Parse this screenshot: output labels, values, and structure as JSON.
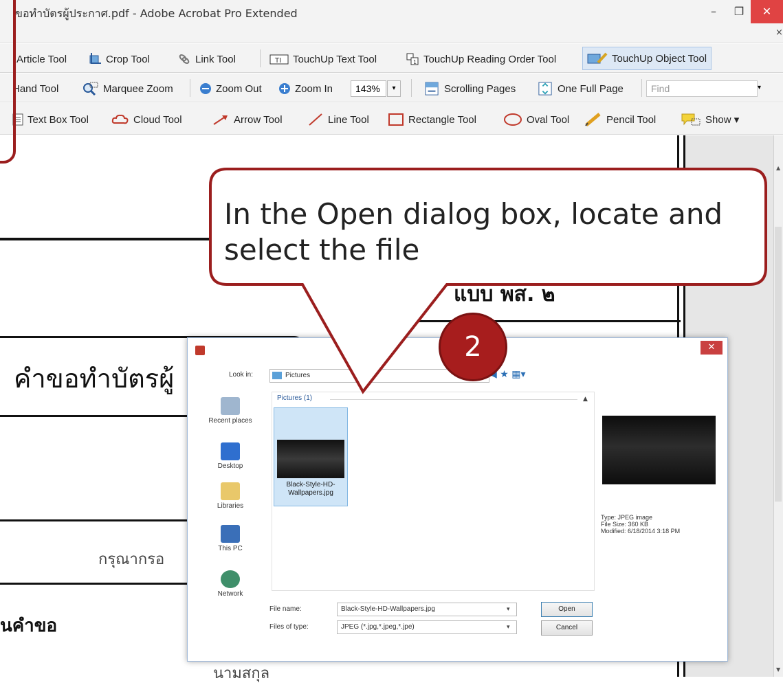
{
  "window": {
    "title": "ขอทำบัตรผู้ประกาศ.pdf - Adobe Acrobat Pro Extended",
    "min": "–",
    "max": "❐",
    "close": "✕",
    "menu_close": "×"
  },
  "toolbar1": {
    "items": [
      "Article Tool",
      "Crop Tool",
      "Link Tool",
      "TouchUp Text Tool",
      "TouchUp Reading Order Tool",
      "TouchUp Object Tool"
    ]
  },
  "toolbar2": {
    "hand": "Hand Tool",
    "marquee": "Marquee Zoom",
    "zoom_out": "Zoom Out",
    "zoom_in": "Zoom In",
    "zoom_value": "143%",
    "scrolling": "Scrolling Pages",
    "one_full": "One Full Page",
    "find_placeholder": "Find"
  },
  "toolbar3": {
    "items": [
      "Text Box Tool",
      "Cloud Tool",
      "Arrow Tool",
      "Line Tool",
      "Rectangle Tool",
      "Oval Tool",
      "Pencil Tool",
      "Show ▾"
    ]
  },
  "document": {
    "heading": "คำขอทำบัตรผู้",
    "form_label": "แบบ พส. ๒",
    "instruction": "กรุณากรอ",
    "section": "นคำขอ",
    "bottom_text": "นามสกุล"
  },
  "callout": {
    "text": "In the Open dialog box, locate and select the file"
  },
  "step": "2",
  "dialog": {
    "close": "✕",
    "look_in_label": "Look in:",
    "look_in_value": "Pictures",
    "toolbar_icons": "◀ ★ ▦▾",
    "places": [
      "Recent places",
      "Desktop",
      "Libraries",
      "This PC",
      "Network"
    ],
    "group_header": "Pictures (1)",
    "file": {
      "name": "Black-Style-HD-Wallpapers.jpg"
    },
    "preview_info": {
      "type": "Type: JPEG image",
      "size": "File Size: 360 KB",
      "modified": "Modified: 6/18/2014 3:18 PM"
    },
    "file_name_label": "File name:",
    "file_name_value": "Black-Style-HD-Wallpapers.jpg",
    "file_type_label": "Files of type:",
    "file_type_value": "JPEG (*.jpg,*.jpeg,*.jpe)",
    "open_button": "Open",
    "cancel_button": "Cancel"
  },
  "colors": {
    "callout_border": "#9b1e1e",
    "step_badge": "#a71d1d",
    "selection": "#cfe5f7"
  }
}
